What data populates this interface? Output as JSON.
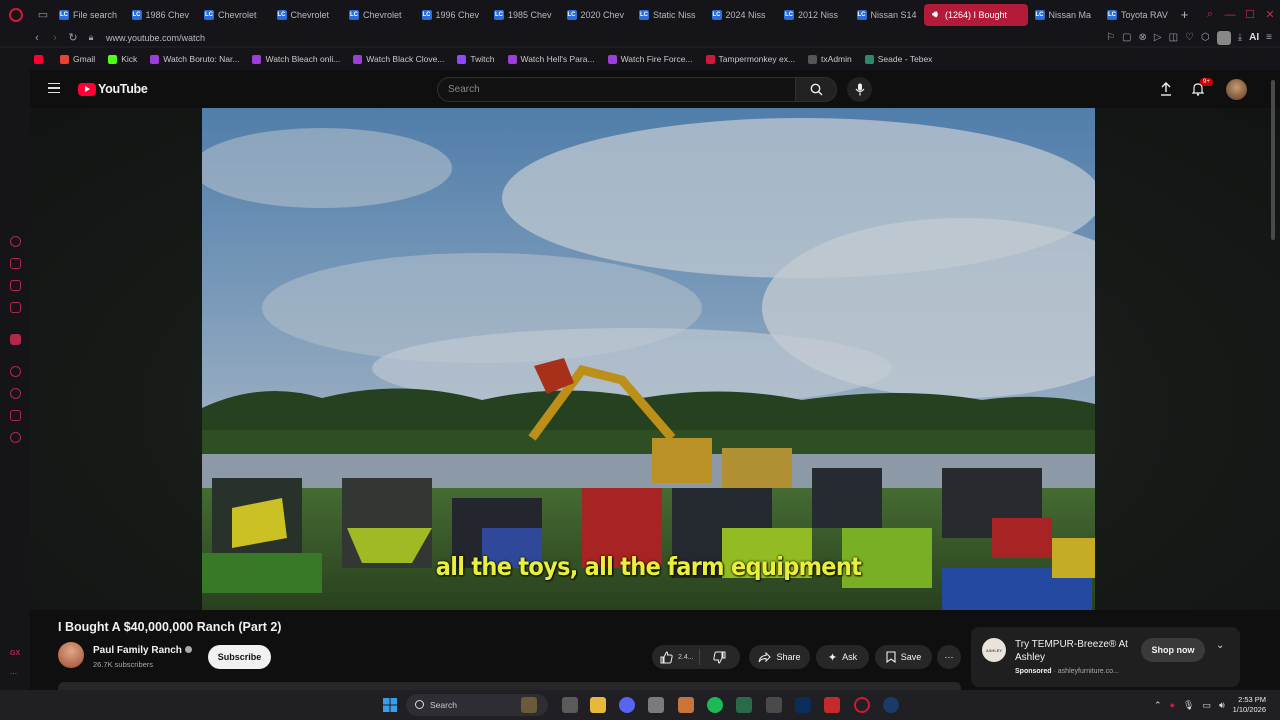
{
  "browser": {
    "tabs": [
      {
        "label": "File search",
        "active": false
      },
      {
        "label": "1986 Chev",
        "active": false
      },
      {
        "label": "Chevrolet",
        "active": false
      },
      {
        "label": "Chevrolet",
        "active": false
      },
      {
        "label": "Chevrolet",
        "active": false
      },
      {
        "label": "1996 Chev",
        "active": false
      },
      {
        "label": "1985 Chev",
        "active": false
      },
      {
        "label": "2020 Chev",
        "active": false
      },
      {
        "label": "Static Niss",
        "active": false
      },
      {
        "label": "2024 Niss",
        "active": false
      },
      {
        "label": "2012 Niss",
        "active": false
      },
      {
        "label": "Nissan S14",
        "active": false
      },
      {
        "label": "(1264) I Bought",
        "active": true
      },
      {
        "label": "Nissan Ma",
        "active": false
      },
      {
        "label": "Toyota RAV",
        "active": false
      }
    ],
    "url": "www.youtube.com/watch",
    "ai_label": "AI",
    "bookmarks": [
      {
        "label": "Gmail",
        "color": "#ea4335"
      },
      {
        "label": "Kick",
        "color": "#53fc18"
      },
      {
        "label": "Watch Boruto: Nar...",
        "color": "#9b3fd6"
      },
      {
        "label": "Watch Bleach onli...",
        "color": "#9b3fd6"
      },
      {
        "label": "Watch Black Clove...",
        "color": "#9b3fd6"
      },
      {
        "label": "Twitch",
        "color": "#9146ff"
      },
      {
        "label": "Watch Hell's Para...",
        "color": "#9b3fd6"
      },
      {
        "label": "Watch Fire Force...",
        "color": "#9b3fd6"
      },
      {
        "label": "Tampermonkey ex...",
        "color": "#d0183a"
      },
      {
        "label": "txAdmin",
        "color": "#555555"
      },
      {
        "label": "Seade - Tebex",
        "color": "#2a8a6a"
      }
    ],
    "sidebar_gx": "GX"
  },
  "youtube": {
    "logo_text": "YouTube",
    "search_placeholder": "Search",
    "notification_badge": "9+",
    "caption": "all the toys, all the farm equipment",
    "video_title": "I Bought A $40,000,000 Ranch (Part 2)",
    "channel_name": "Paul Family Ranch",
    "subscribers": "26.7K subscribers",
    "subscribe_label": "Subscribe",
    "like_count": "2.4...",
    "share_label": "Share",
    "ask_label": "Ask",
    "save_label": "Save",
    "more_label": "⋯",
    "ad": {
      "logo_text": "ASHLEY",
      "title": "Try TEMPUR-Breeze® At Ashley",
      "sponsored": "Sponsored",
      "domain": "· ashleyfurniture.co...",
      "cta": "Shop now"
    }
  },
  "taskbar": {
    "search_label": "Search",
    "time": "2:53 PM",
    "date": "1/10/2026"
  },
  "colors": {
    "accent": "#d0183a",
    "yt_red": "#ff0033",
    "caption": "#e9ef3a"
  }
}
